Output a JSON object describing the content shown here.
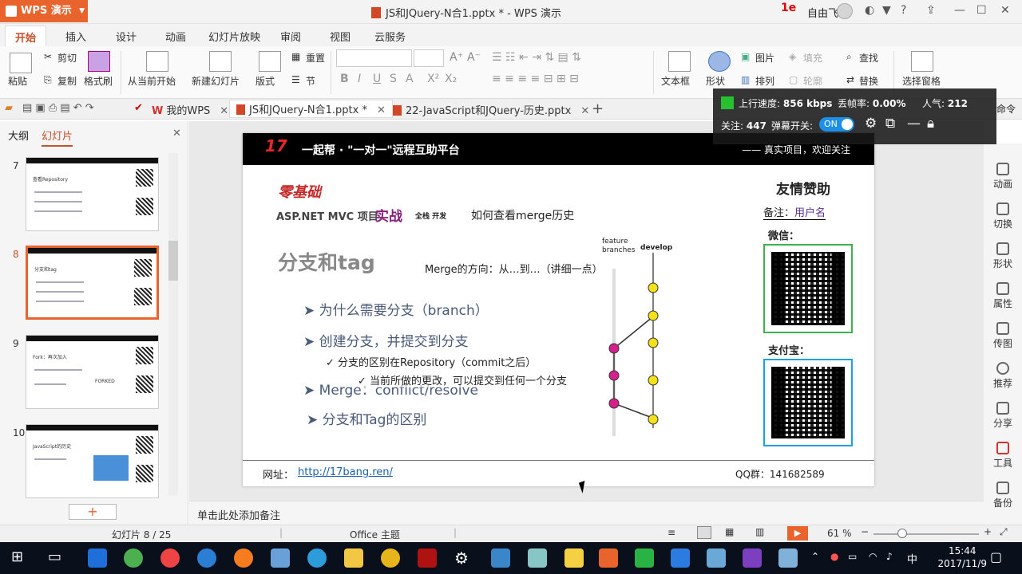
{
  "window": {
    "app_button": "WPS 演示",
    "title": "JS和JQuery-N合1.pptx * - WPS 演示",
    "user_name": "自由飞",
    "user_logo": "1e"
  },
  "menu_tabs": [
    "开始",
    "插入",
    "设计",
    "动画",
    "幻灯片放映",
    "审阅",
    "视图",
    "云服务"
  ],
  "ribbon": {
    "paste": "粘贴",
    "cut": "剪切",
    "copy": "复制",
    "format_painter": "格式刷",
    "from_current": "从当前开始",
    "new_slide": "新建幻灯片",
    "layout": "版式",
    "reset": "重置",
    "section": "节",
    "text_box": "文本框",
    "shape": "形状",
    "picture": "图片",
    "fill": "填充",
    "arrange": "排列",
    "outline": "轮廓",
    "find": "查找",
    "replace": "替换",
    "select_pane": "选择窗格",
    "font_buttons": [
      "B",
      "I",
      "U",
      "S",
      "A",
      "X²",
      "X₂"
    ]
  },
  "doc_tabs": [
    {
      "label": "我的WPS",
      "prefix": "W"
    },
    {
      "label": "JS和JQuery-N合1.pptx *",
      "active": true
    },
    {
      "label": "22-JavaScript和JQuery-历史.pptx"
    }
  ],
  "command_partial": "命令",
  "left_panel": {
    "tab_outline": "大纲",
    "tab_slides": "幻灯片",
    "thumbnails": [
      {
        "num": "7",
        "text": "查看Repository"
      },
      {
        "num": "8",
        "text": "分支和tag"
      },
      {
        "num": "9",
        "text": "Fork：再次加入",
        "extra": "FORKED"
      },
      {
        "num": "10",
        "text": "JavaScript的历史"
      }
    ],
    "add_button": "+"
  },
  "slide": {
    "banner_left": "一起帮 · \"一对一\"远程互助平台",
    "banner_right": "—— 真实项目，欢迎关注",
    "logo_text": "17bang",
    "zero_base": "零基础",
    "course_line": "ASP.NET MVC 项目",
    "shizhan": "实战",
    "quanzhan": "全栈 开发",
    "how_merge": "如何查看merge历史",
    "title": "分支和tag",
    "merge_dir": "Merge的方向：从…到…（讲细一点）",
    "feature_label": "feature branches",
    "develop_label": "develop",
    "bullets": [
      "为什么需要分支（branch）",
      "创建分支，并提交到分支",
      "分支的区别在Repository（commit之后）",
      "当前所做的更改，可以提交到任何一个分支",
      "Merge：conflict/resolve",
      "分支和Tag的区别"
    ],
    "friend_help": "友情赞助",
    "note_label": "备注：",
    "note_value": "用户名",
    "wechat": "微信：",
    "alipay": "支付宝：",
    "website_label": "网址：",
    "website_url": "http://17bang.ren/",
    "qq_group": "QQ群：141682589"
  },
  "notes_placeholder": "单击此处添加备注",
  "right_sidebar": [
    "动画",
    "切换",
    "形状",
    "属性",
    "传图",
    "推荐",
    "分享",
    "工具",
    "备份"
  ],
  "overlay": {
    "upload_label": "上行速度:",
    "upload_value": "856 kbps",
    "loss_label": "丢帧率:",
    "loss_value": "0.00%",
    "popularity_label": "人气:",
    "popularity_value": "212",
    "follow_label": "关注:",
    "follow_value": "447",
    "danmu_label": "弹幕开关:",
    "toggle": "ON"
  },
  "status": {
    "slide_info": "幻灯片 8 / 25",
    "theme": "Office 主题",
    "zoom": "61 %"
  },
  "taskbar": {
    "time": "15:44",
    "date": "2017/11/9",
    "ime": "中"
  }
}
